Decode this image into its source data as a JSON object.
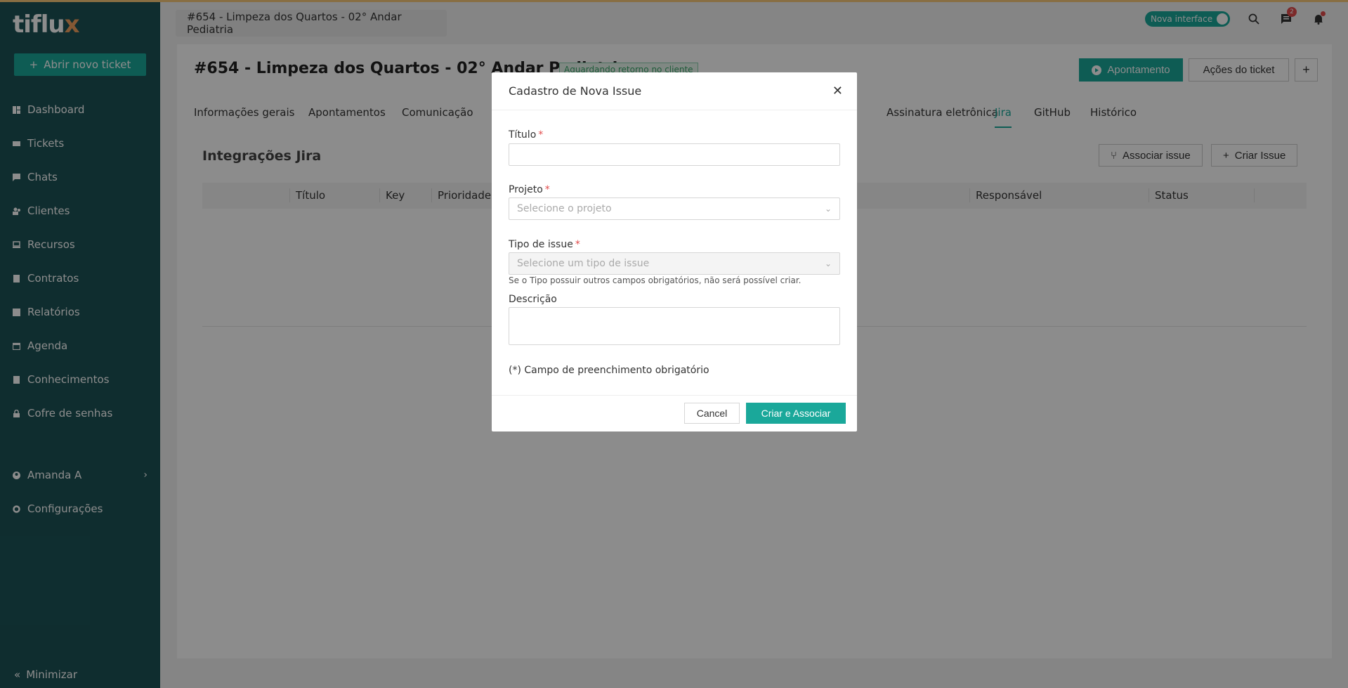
{
  "app": {
    "logo": "tiflu",
    "logo_x": "x"
  },
  "sidebar": {
    "new_ticket": "Abrir novo ticket",
    "items": [
      {
        "label": "Dashboard",
        "icon": "dashboard-icon"
      },
      {
        "label": "Tickets",
        "icon": "tickets-icon"
      },
      {
        "label": "Chats",
        "icon": "chats-icon"
      },
      {
        "label": "Clientes",
        "icon": "clients-icon"
      },
      {
        "label": "Recursos",
        "icon": "resources-icon"
      },
      {
        "label": "Contratos",
        "icon": "contracts-icon"
      },
      {
        "label": "Relatórios",
        "icon": "reports-icon"
      },
      {
        "label": "Agenda",
        "icon": "calendar-icon"
      },
      {
        "label": "Conhecimentos",
        "icon": "knowledge-icon"
      },
      {
        "label": "Cofre de senhas",
        "icon": "lock-icon"
      }
    ],
    "user": "Amanda A",
    "settings": "Configurações",
    "minimize": "Minimizar"
  },
  "header": {
    "tab_title": "#654 - Limpeza dos Quartos - 02° Andar Pediatria",
    "nova_interface": "Nova interface",
    "notifications_count": "2"
  },
  "ticket": {
    "title": "#654 - Limpeza dos Quartos - 02° Andar Pediatria",
    "status": "Aguardando retorno no cliente",
    "apontamento": "Apontamento",
    "acoes": "Ações do ticket",
    "plus": "+"
  },
  "tabs": [
    {
      "label": "Informações gerais"
    },
    {
      "label": "Apontamentos"
    },
    {
      "label": "Comunicação"
    },
    {
      "label": "Assinatura eletrônica"
    },
    {
      "label": "Jira"
    },
    {
      "label": "GitHub"
    },
    {
      "label": "Histórico"
    }
  ],
  "jira": {
    "title": "Integrações Jira",
    "associar": "Associar issue",
    "criar": "Criar Issue",
    "columns": [
      "Título",
      "Key",
      "Prioridade",
      "Responsável",
      "Status"
    ]
  },
  "modal": {
    "title": "Cadastro de Nova Issue",
    "titulo_label": "Título",
    "projeto_label": "Projeto",
    "projeto_placeholder": "Selecione o projeto",
    "tipo_label": "Tipo de issue",
    "tipo_placeholder": "Selecione um tipo de issue",
    "hint": "Se o Tipo possuir outros campos obrigatórios, não será possível criar.",
    "descricao_label": "Descrição",
    "note": "(*) Campo de preenchimento obrigatório",
    "cancel": "Cancel",
    "submit": "Criar e Associar"
  },
  "colors": {
    "primary": "#1aa89a",
    "sidebar": "#1c5357",
    "danger": "#e24b4b"
  }
}
